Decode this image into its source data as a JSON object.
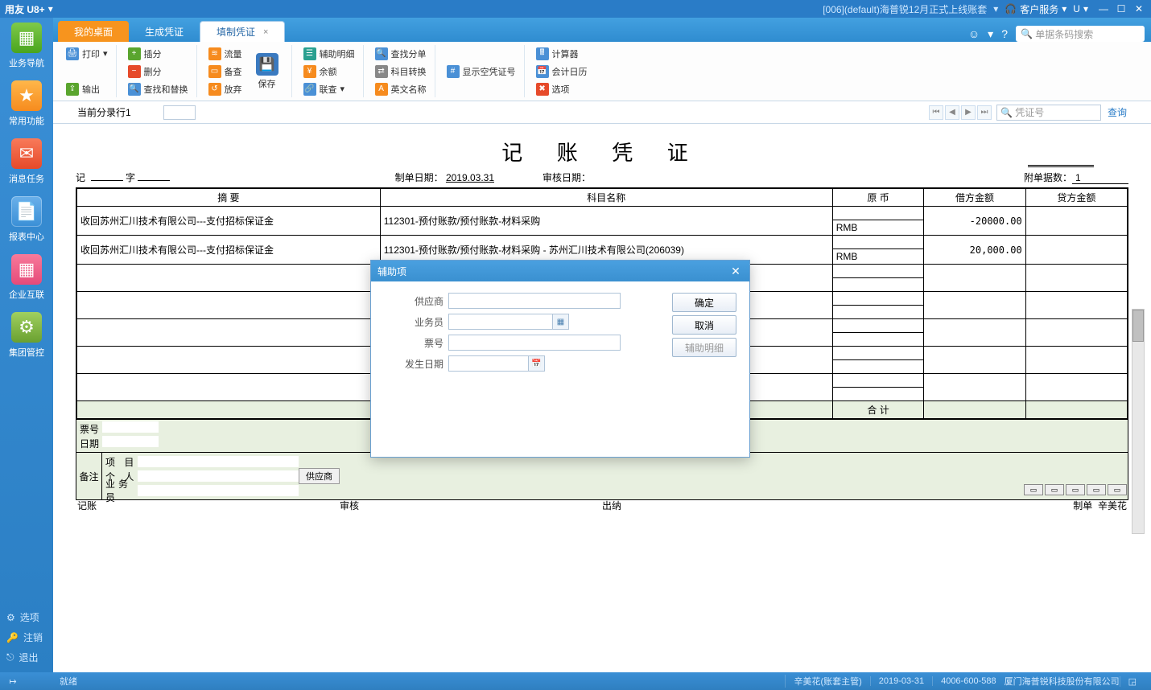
{
  "titlebar": {
    "app": "用友 U8+",
    "account": "[006](default)海普锐12月正式上线账套",
    "service": "客户服务",
    "u_label": "U"
  },
  "leftnav": {
    "items": [
      {
        "label": "业务导航"
      },
      {
        "label": "常用功能"
      },
      {
        "label": "消息任务"
      },
      {
        "label": "报表中心"
      },
      {
        "label": "企业互联"
      },
      {
        "label": "集团管控"
      }
    ],
    "bottom": {
      "options": "选项",
      "logout": "注销",
      "exit": "退出"
    }
  },
  "tabs": {
    "t0": "我的桌面",
    "t1": "生成凭证",
    "t2": "填制凭证"
  },
  "tab_search_placeholder": "单据条码搜索",
  "ribbon": {
    "print": "打印",
    "output": "输出",
    "insert": "插分",
    "delete": "删分",
    "findreplace": "查找和替换",
    "flow": "流量",
    "backup": "备查",
    "abandon": "放弃",
    "save": "保存",
    "auxdetail": "辅助明细",
    "balance": "余额",
    "joincheck": "联查",
    "findsplit": "查找分单",
    "acctconv": "科目转换",
    "enname": "英文名称",
    "showempty": "显示空凭证号",
    "calc": "计算器",
    "acctcal": "会计日历",
    "options": "选项"
  },
  "subbar": {
    "label": "当前分录行1",
    "search_placeholder": "凭证号",
    "query": "查询"
  },
  "voucher": {
    "title": "记 账 凭 证",
    "prefix_ji": "记",
    "prefix_zi": "字",
    "make_date_label": "制单日期：",
    "make_date": "2019.03.31",
    "audit_date_label": "审核日期：",
    "attach_label": "附单据数：",
    "attach_count": "1",
    "headers": {
      "summary": "摘 要",
      "account": "科目名称",
      "currency": "原 币",
      "debit": "借方金额",
      "credit": "贷方金额"
    },
    "rows": [
      {
        "summary": "收回苏州汇川技术有限公司---支付招标保证金",
        "account": "112301-预付账款/预付账款-材料采购",
        "curr": "RMB",
        "debit": "-20000.00",
        "credit": ""
      },
      {
        "summary": "收回苏州汇川技术有限公司---支付招标保证金",
        "account": "112301-预付账款/预付账款-材料采购 - 苏州汇川技术有限公司(206039)",
        "curr": "RMB",
        "debit": "20,000.00",
        "credit": ""
      }
    ],
    "total_label": "合 计",
    "bill_label": "票号",
    "date_label": "日期",
    "remark_label": "备注",
    "proj_label": "项 目",
    "person_label": "个 人",
    "staff_label": "业务员",
    "supplier_tag": "供应商",
    "foot": {
      "jizhang": "记账",
      "audit": "审核",
      "cashier": "出纳",
      "maker_label": "制单",
      "maker": "辛美花"
    }
  },
  "modal": {
    "title": "辅助项",
    "supplier": "供应商",
    "staff": "业务员",
    "bill": "票号",
    "date": "发生日期",
    "ok": "确定",
    "cancel": "取消",
    "aux": "辅助明细"
  },
  "statusbar": {
    "ready": "就绪",
    "user": "辛美花(账套主管)",
    "date": "2019-03-31",
    "hotline": "4006-600-588",
    "company": "厦门海普锐科技股份有限公司"
  }
}
